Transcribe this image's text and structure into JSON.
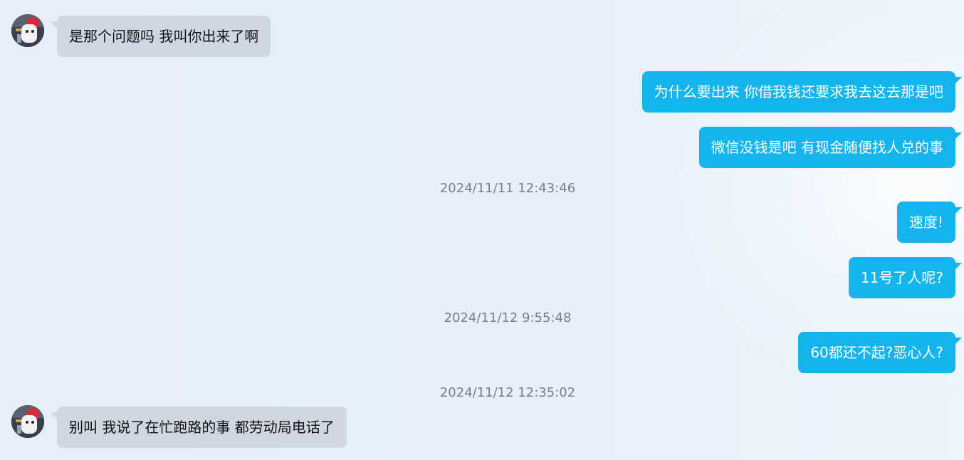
{
  "colors": {
    "incoming_bubble": "#cfd7e2",
    "outgoing_bubble": "#14b4ef",
    "timestamp_text": "#7a7f87"
  },
  "messages": [
    {
      "direction": "incoming",
      "text": "是那个问题吗  我叫你出来了啊"
    },
    {
      "direction": "outgoing",
      "text": "为什么要出来 你借我钱还要求我去这去那是吧"
    },
    {
      "direction": "outgoing",
      "text": "微信没钱是吧 有现金随便找人兑的事"
    },
    {
      "direction": "outgoing",
      "text": "速度!"
    },
    {
      "direction": "outgoing",
      "text": "11号了人呢?"
    },
    {
      "direction": "outgoing",
      "text": "60都还不起?恶心人?"
    },
    {
      "direction": "incoming",
      "text": "别叫 我说了在忙跑路的事  都劳动局电话了"
    }
  ],
  "timestamps": [
    "2024/11/11 12:43:46",
    "2024/11/12 9:55:48",
    "2024/11/12 12:35:02"
  ],
  "icons": {
    "contact_avatar": "avatar-icon"
  }
}
